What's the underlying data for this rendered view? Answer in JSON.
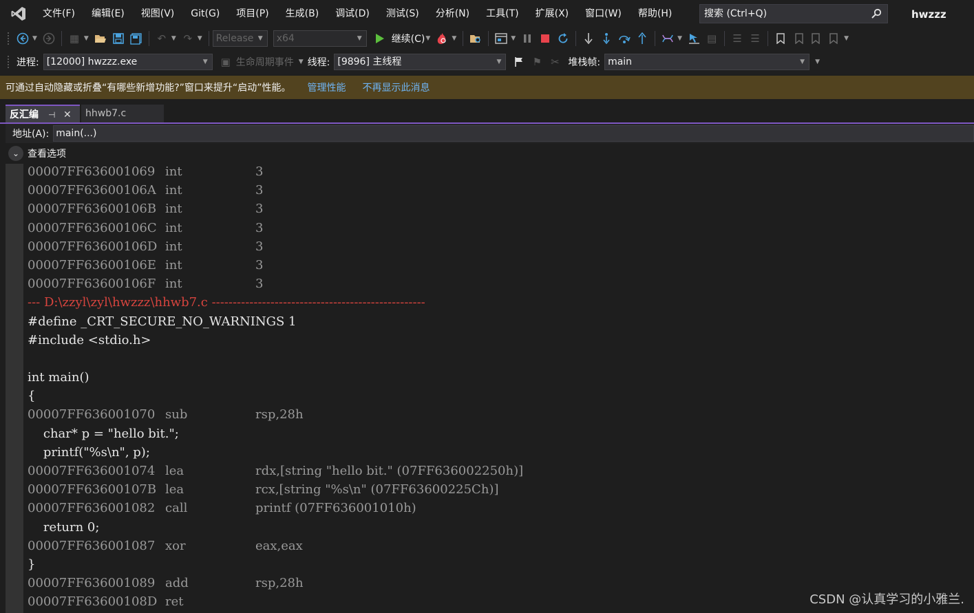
{
  "menubar": {
    "items": [
      "文件(F)",
      "编辑(E)",
      "视图(V)",
      "Git(G)",
      "项目(P)",
      "生成(B)",
      "调试(D)",
      "测试(S)",
      "分析(N)",
      "工具(T)",
      "扩展(X)",
      "窗口(W)",
      "帮助(H)"
    ],
    "search_placeholder": "搜索 (Ctrl+Q)",
    "solution_name": "hwzzz"
  },
  "toolbar": {
    "configuration": "Release",
    "platform": "x64",
    "continue_label": "继续(C)"
  },
  "debug_location": {
    "process_label": "进程:",
    "process_value": "[12000] hwzzz.exe",
    "lifecycle_label": "生命周期事件",
    "thread_label": "线程:",
    "thread_value": "[9896] 主线程",
    "stackframe_label": "堆栈帧:",
    "stackframe_value": "main"
  },
  "infobar": {
    "message": "可通过自动隐藏或折叠“有哪些新增功能?”窗口来提升“启动”性能。",
    "link_manage": "管理性能",
    "link_dismiss": "不再显示此消息"
  },
  "tabs": {
    "active": "反汇编",
    "inactive": "hhwb7.c"
  },
  "disasm": {
    "address_label": "地址(A):",
    "address_value": "main(...)",
    "view_options": "查看选项",
    "lines": [
      {
        "kind": "asm",
        "addr": "00007FF636001069",
        "mnem": "int",
        "oper": "3"
      },
      {
        "kind": "asm",
        "addr": "00007FF63600106A",
        "mnem": "int",
        "oper": "3"
      },
      {
        "kind": "asm",
        "addr": "00007FF63600106B",
        "mnem": "int",
        "oper": "3"
      },
      {
        "kind": "asm",
        "addr": "00007FF63600106C",
        "mnem": "int",
        "oper": "3"
      },
      {
        "kind": "asm",
        "addr": "00007FF63600106D",
        "mnem": "int",
        "oper": "3"
      },
      {
        "kind": "asm",
        "addr": "00007FF63600106E",
        "mnem": "int",
        "oper": "3"
      },
      {
        "kind": "asm",
        "addr": "00007FF63600106F",
        "mnem": "int",
        "oper": "3"
      },
      {
        "kind": "sep",
        "text": "--- D:\\zzyl\\zyl\\hwzzz\\hhwb7.c ---------------------------------------------------"
      },
      {
        "kind": "src",
        "text": "#define _CRT_SECURE_NO_WARNINGS 1"
      },
      {
        "kind": "src",
        "text": "#include <stdio.h>"
      },
      {
        "kind": "src",
        "text": ""
      },
      {
        "kind": "src",
        "text": "int main()"
      },
      {
        "kind": "src",
        "text": "{"
      },
      {
        "kind": "asm",
        "addr": "00007FF636001070",
        "mnem": "sub",
        "oper": "rsp,28h",
        "current": true
      },
      {
        "kind": "src",
        "text": "    char* p = \"hello bit.\";"
      },
      {
        "kind": "src",
        "text": "    printf(\"%s\\n\", p);"
      },
      {
        "kind": "asm",
        "addr": "00007FF636001074",
        "mnem": "lea",
        "oper": "rdx,[string \"hello bit.\" (07FF636002250h)]"
      },
      {
        "kind": "asm",
        "addr": "00007FF63600107B",
        "mnem": "lea",
        "oper": "rcx,[string \"%s\\n\" (07FF63600225Ch)]"
      },
      {
        "kind": "asm",
        "addr": "00007FF636001082",
        "mnem": "call",
        "oper": "printf (07FF636001010h)"
      },
      {
        "kind": "src",
        "text": "    return 0;"
      },
      {
        "kind": "asm",
        "addr": "00007FF636001087",
        "mnem": "xor",
        "oper": "eax,eax"
      },
      {
        "kind": "src",
        "text": "}"
      },
      {
        "kind": "asm",
        "addr": "00007FF636001089",
        "mnem": "add",
        "oper": "rsp,28h"
      },
      {
        "kind": "asm",
        "addr": "00007FF63600108D",
        "mnem": "ret",
        "oper": ""
      }
    ]
  },
  "watermark": "CSDN @认真学习的小雅兰.",
  "colors": {
    "background": "#1e1e1e",
    "infobar": "#52431f",
    "accent": "#7e57c2",
    "source_separator": "#d7443e",
    "link": "#6fb3f2",
    "current_instruction_arrow": "#f0b429"
  }
}
